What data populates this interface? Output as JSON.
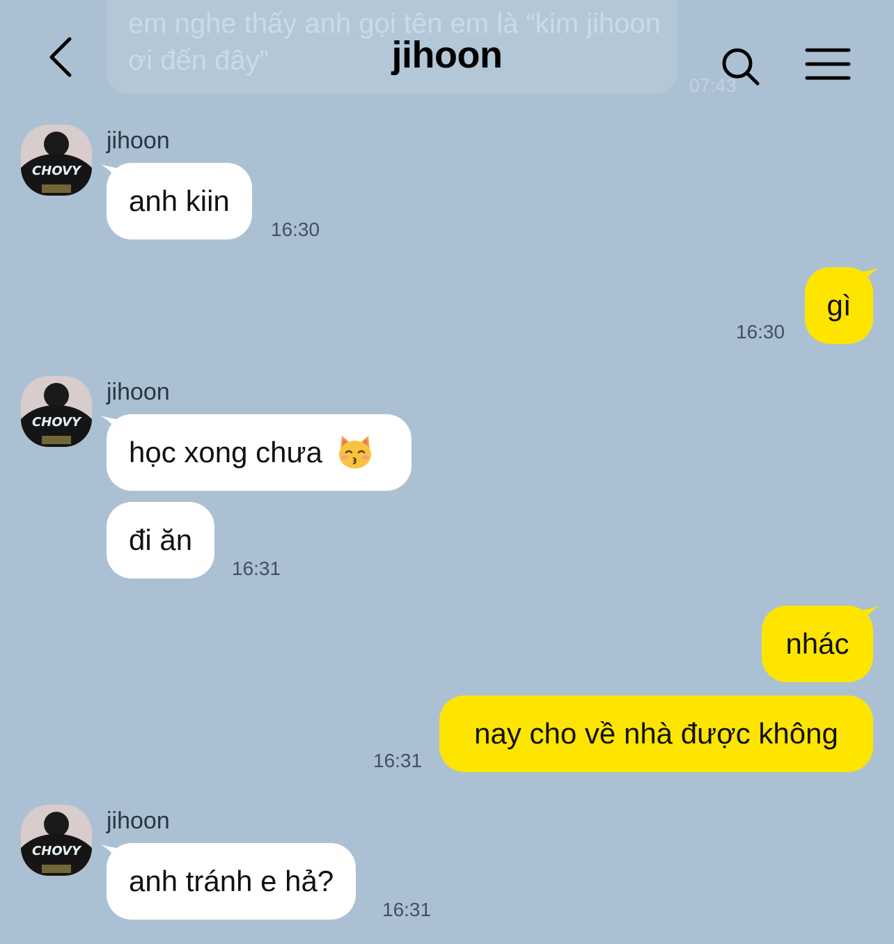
{
  "header": {
    "title": "jihoon",
    "back_icon": "chevron-left-icon",
    "search_icon": "search-icon",
    "menu_icon": "hamburger-menu-icon"
  },
  "faded_message": {
    "text": "em nghe thấy anh gọi tên em là “kim jihoon ơi đến đây”",
    "time": "07:43"
  },
  "colors": {
    "background": "#abc1d3",
    "incoming_bubble": "#ffffff",
    "outgoing_bubble": "#fee500"
  },
  "messages": [
    {
      "sender": "jihoon",
      "text": "anh kiin",
      "time": "16:30"
    },
    {
      "sender": "me",
      "text": "gì",
      "time": "16:30"
    },
    {
      "sender": "jihoon",
      "text": "học xong chưa",
      "emoji": "kissing-cat-emoji"
    },
    {
      "sender": "jihoon",
      "text": "đi ăn",
      "time": "16:31"
    },
    {
      "sender": "me",
      "text": "nhác"
    },
    {
      "sender": "me",
      "text": "nay cho về nhà được không",
      "time": "16:31"
    },
    {
      "sender": "jihoon",
      "text": "anh tránh e hả?",
      "time": "16:31"
    }
  ],
  "avatar": {
    "shirt_text": "CHOVY"
  }
}
